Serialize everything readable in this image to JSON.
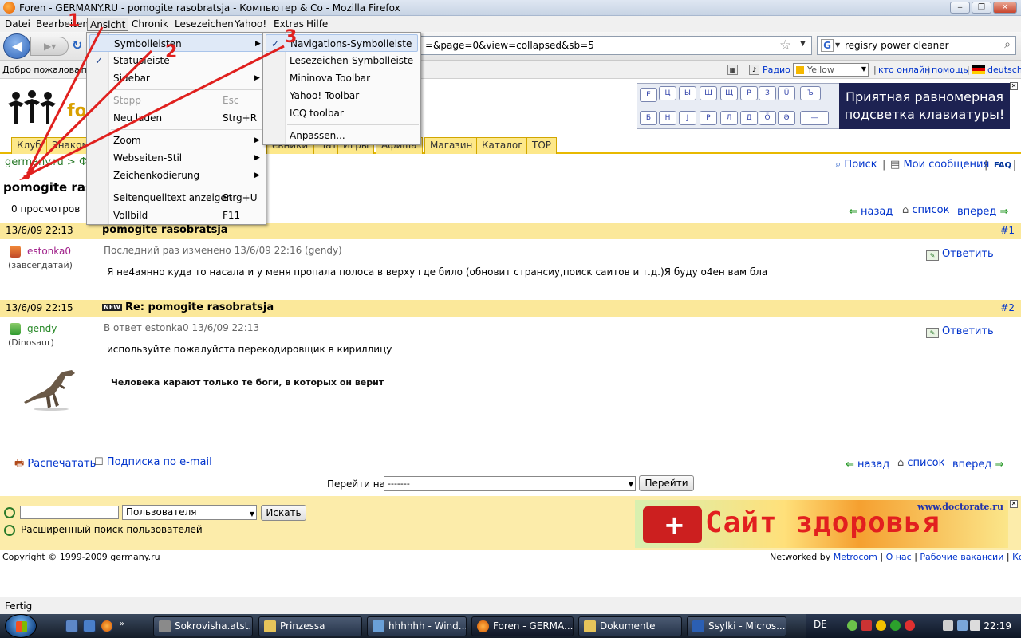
{
  "window": {
    "title": "Foren - GERMANY.RU - pomogite rasobratsja - Компьютер & Co - Mozilla Firefox"
  },
  "menubar": [
    "Datei",
    "Bearbeiten",
    "Ansicht",
    "Chronik",
    "Lesezeichen",
    "Yahoo!",
    "Extras",
    "Hilfe"
  ],
  "navbar": {
    "url_visible": "=&page=0&view=collapsed&sb=5",
    "search_value": "regisry power cleaner"
  },
  "bookmarks": {
    "welcome": "Добро пожаловать",
    "radio": "Радио",
    "color": "Yellow",
    "online": "кто онлайн",
    "help": "помощь",
    "lang": "deutsch"
  },
  "ad_keyboard": {
    "keys_top": [
      "Е",
      "Ц",
      "Ы",
      "Ш",
      "Щ",
      "Р",
      "З",
      "Ü",
      "Ъ"
    ],
    "keys_bottom": [
      "Б",
      "Н",
      "Ј",
      "Р",
      "Л",
      "Д",
      "Ö",
      "Ә"
    ],
    "text": "Приятная равномерная подсветка клавиатуры!"
  },
  "page_tabs": [
    "Клуб",
    "Знаком",
    "евники",
    "Чат",
    "Игры",
    "Афиша",
    "Магазин",
    "Каталог",
    "TOP"
  ],
  "breadcrumb": "germany.ru > Фо",
  "tools": {
    "search": "Поиск",
    "messages": "Мои сообщения",
    "faq": "FAQ"
  },
  "topic_title": "pomogite rasobratsja",
  "views": "0 просмотров",
  "nav": {
    "back": "назад",
    "list": "список",
    "forward": "вперед"
  },
  "posts": [
    {
      "date": "13/6/09 22:13",
      "title": "pomogite rasobratsja",
      "num": "#1",
      "user": "estonka0",
      "rank": "(завсегдатай)",
      "meta": "Последний раз изменено 13/6/09 22:16 (gendy)",
      "body": "Я не4аянно куда то насала и у меня пропала полоса в верху где било (обновит странсиу,поиск саитов и т.д.)Я буду о4ен вам бла",
      "reply": "Ответить"
    },
    {
      "date": "13/6/09 22:15",
      "badge": "NEW",
      "title": "Re: pomogite rasobratsja",
      "num": "#2",
      "user": "gendy",
      "rank": "(Dinosaur)",
      "meta": "В ответ estonka0 13/6/09 22:13",
      "body": "используйте пожалуйста перекодировщик в кириллицу",
      "signature": "Человека карают только те боги, в которых он верит",
      "reply": "Ответить"
    }
  ],
  "footer_actions": {
    "print": "Распечатать",
    "subscribe": "Подписка по e-mail"
  },
  "goto": {
    "label": "Перейти на",
    "selected": "-------",
    "button": "Перейти"
  },
  "user_search": {
    "select": "Пользователя",
    "button": "Искать",
    "advanced": "Расширенный поиск пользователей"
  },
  "ad_health": {
    "text": "Сайт здоровья",
    "url": "www.doctorate.ru"
  },
  "copyright": "Copyright © 1999-2009 germany.ru",
  "footer_links": {
    "networked": "Networked by",
    "metrocom": "Metrocom",
    "about": "О нас",
    "jobs": "Рабочие вакансии",
    "contact": "Контакт"
  },
  "status": "Fertig",
  "view_menu": {
    "items": [
      {
        "label": "Symbolleisten",
        "submenu": true
      },
      {
        "label": "Statusleiste",
        "checked": true
      },
      {
        "label": "Sidebar",
        "submenu": true
      },
      {
        "label": "Stopp",
        "shortcut": "Esc",
        "disabled": true
      },
      {
        "label": "Neu laden",
        "shortcut": "Strg+R"
      },
      {
        "label": "Zoom",
        "submenu": true
      },
      {
        "label": "Webseiten-Stil",
        "submenu": true
      },
      {
        "label": "Zeichenkodierung",
        "submenu": true
      },
      {
        "label": "Seitenquelltext anzeigen",
        "shortcut": "Strg+U"
      },
      {
        "label": "Vollbild",
        "shortcut": "F11"
      }
    ]
  },
  "toolbars_menu": {
    "items": [
      {
        "label": "Navigations-Symbolleiste",
        "checked": true
      },
      {
        "label": "Lesezeichen-Symbolleiste"
      },
      {
        "label": "Mininova Toolbar"
      },
      {
        "label": "Yahoo! Toolbar"
      },
      {
        "label": "ICQ toolbar"
      },
      {
        "label": "Anpassen..."
      }
    ]
  },
  "annotations": [
    "1",
    "2",
    "3"
  ],
  "annotation_color": "#e0201e",
  "taskbar": {
    "buttons": [
      "Sokrovisha.atst...",
      "Prinzessa",
      "hhhhhh - Wind...",
      "Foren - GERMA...",
      "Dokumente",
      "Ssylki - Micros..."
    ],
    "lang": "DE",
    "clock": "22:19"
  }
}
